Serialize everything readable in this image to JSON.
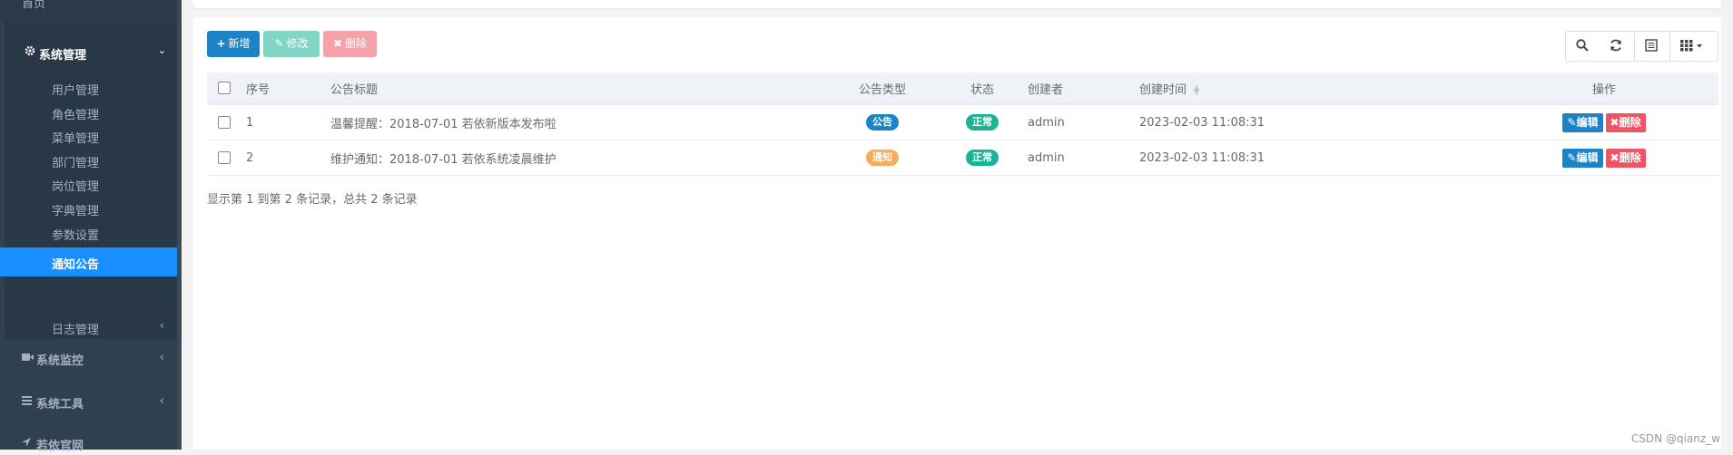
{
  "sidebar": {
    "home_label": "首页",
    "system_menu": {
      "label": "系统管理",
      "chevron": "⌄"
    },
    "sub_items": [
      {
        "label": "用户管理"
      },
      {
        "label": "角色管理"
      },
      {
        "label": "菜单管理"
      },
      {
        "label": "部门管理"
      },
      {
        "label": "岗位管理"
      },
      {
        "label": "字典管理"
      },
      {
        "label": "参数设置"
      },
      {
        "label": "通知公告",
        "active": true
      },
      {
        "label": "日志管理",
        "chevron": "‹"
      }
    ],
    "monitor": {
      "label": "系统监控",
      "chevron": "‹"
    },
    "tools": {
      "label": "系统工具",
      "chevron": "‹"
    },
    "website": {
      "label": "若依官网"
    }
  },
  "toolbar": {
    "add_label": "新增",
    "edit_label": "修改",
    "delete_label": "删除",
    "add_glyph": "+",
    "edit_glyph": "✎",
    "delete_glyph": "✖"
  },
  "table": {
    "headers": {
      "index": "序号",
      "title": "公告标题",
      "type": "公告类型",
      "status": "状态",
      "creator": "创建者",
      "created": "创建时间",
      "actions": "操作"
    },
    "rows": [
      {
        "index": "1",
        "title": "温馨提醒：2018-07-01 若依新版本发布啦",
        "type": "公告",
        "status": "正常",
        "creator": "admin",
        "created": "2023-02-03 11:08:31",
        "edit": "编辑",
        "delete": "删除"
      },
      {
        "index": "2",
        "title": "维护通知：2018-07-01 若依系统凌晨维护",
        "type": "通知",
        "status": "正常",
        "creator": "admin",
        "created": "2023-02-03 11:08:31",
        "edit": "编辑",
        "delete": "删除"
      }
    ]
  },
  "pagination": {
    "text": "显示第 1 到第 2 条记录，总共 2 条记录"
  },
  "watermark": "CSDN @qianz_w",
  "colors": {
    "sidebar_bg": "#2f4050",
    "active_item": "#1890ff",
    "primary": "#1c84c6",
    "success": "#1ab394",
    "warning": "#f8ac59",
    "danger": "#ed5565"
  }
}
